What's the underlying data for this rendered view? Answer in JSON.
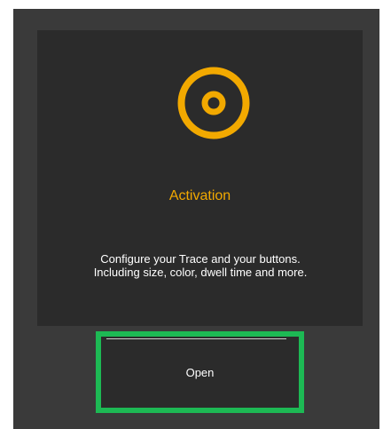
{
  "card": {
    "icon": "activation-ring-icon",
    "title": "Activation",
    "description": "Configure your Trace and your buttons. Including size, color, dwell time and more."
  },
  "open_button": {
    "label": "Open"
  },
  "colors": {
    "accent": "#f2a900",
    "highlight_border": "#1db954",
    "panel_bg": "#3a3a3a",
    "card_bg": "#2b2b2b",
    "text": "#ffffff"
  }
}
